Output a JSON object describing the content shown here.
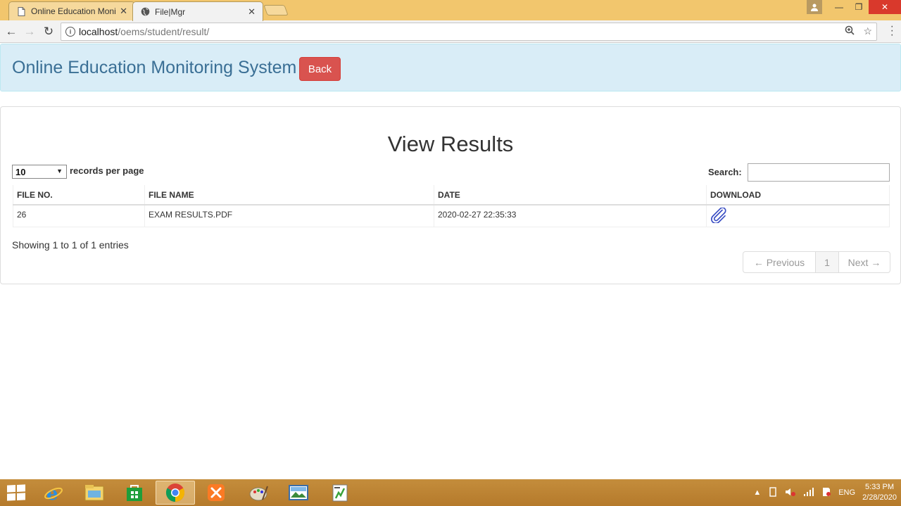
{
  "browser": {
    "tabs": [
      {
        "label": "Online Education Monito",
        "active": false
      },
      {
        "label": "File|Mgr",
        "active": true
      }
    ],
    "url_host": "localhost",
    "url_path": "/oems/student/result/"
  },
  "header": {
    "title": "Online Education Monitoring System",
    "back_label": "Back"
  },
  "panel": {
    "title": "View Results",
    "page_length": "10",
    "length_label": "records per page",
    "search_label": "Search:",
    "search_value": ""
  },
  "table": {
    "columns": [
      "FILE NO.",
      "FILE NAME",
      "DATE",
      "DOWNLOAD"
    ],
    "rows": [
      {
        "file_no": "26",
        "file_name": "EXAM RESULTS.PDF",
        "date": "2020-02-27 22:35:33"
      }
    ]
  },
  "footer": {
    "info": "Showing 1 to 1 of 1 entries",
    "prev_label": "← Previous",
    "page": "1",
    "next_label": "Next →"
  },
  "taskbar": {
    "lang": "ENG",
    "time": "5:33 PM",
    "date": "2/28/2020"
  },
  "colors": {
    "header_bg": "#d9edf7",
    "back_button": "#d9534f",
    "clip_icon": "#3b4fc4",
    "taskbar": "#c48d3c"
  }
}
